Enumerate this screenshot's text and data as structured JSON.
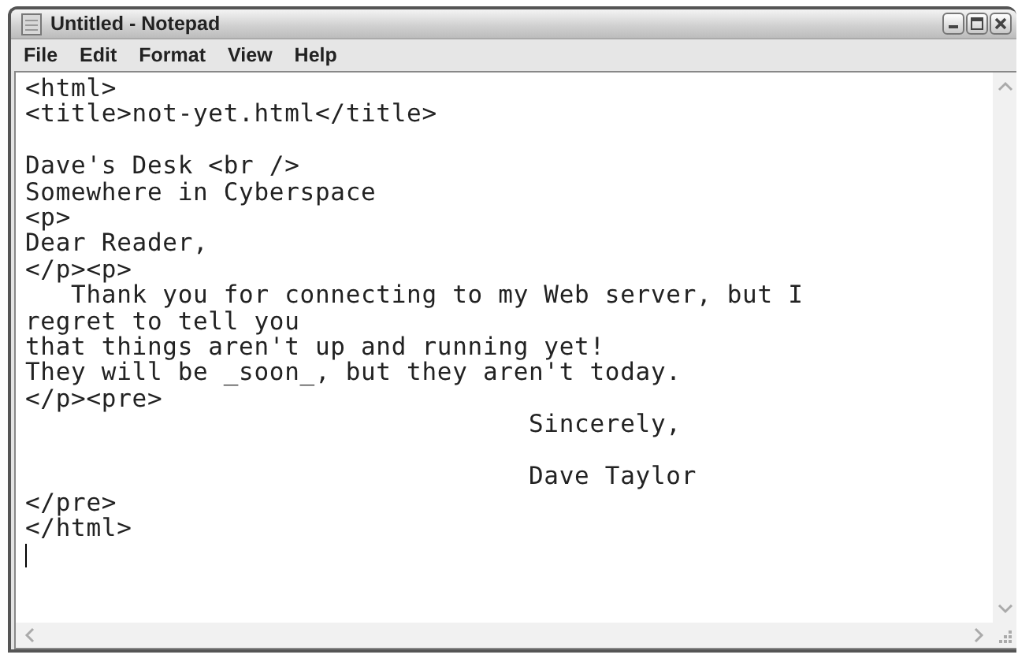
{
  "window": {
    "title": "Untitled - Notepad"
  },
  "menu": [
    "File",
    "Edit",
    "Format",
    "View",
    "Help"
  ],
  "editor": {
    "text": "<html>\n<title>not-yet.html</title>\n\nDave's Desk <br />\nSomewhere in Cyberspace\n<p>\nDear Reader,\n</p><p>\n   Thank you for connecting to my Web server, but I\nregret to tell you\nthat things aren't up and running yet!\nThey will be _soon_, but they aren't today.\n</p><pre>\n                                 Sincerely,\n\n                                 Dave Taylor\n</pre>\n</html>"
  }
}
